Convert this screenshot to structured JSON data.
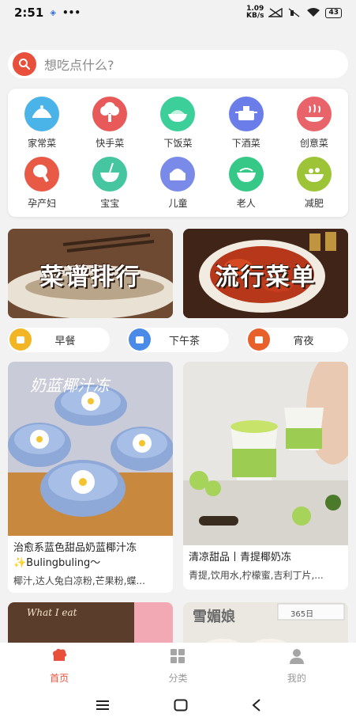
{
  "status_bar": {
    "time": "2:51",
    "net_speed_value": "1.09",
    "net_speed_unit": "KB/s",
    "battery": "43"
  },
  "search": {
    "placeholder": "想吃点什么?"
  },
  "categories": [
    {
      "label": "家常菜",
      "icon": "cloche-icon",
      "color": "#4ab3e8"
    },
    {
      "label": "快手菜",
      "icon": "broccoli-icon",
      "color": "#e85a5a"
    },
    {
      "label": "下饭菜",
      "icon": "rice-bowl-icon",
      "color": "#3ccf9a"
    },
    {
      "label": "下酒菜",
      "icon": "pot-icon",
      "color": "#6a7de8"
    },
    {
      "label": "创意菜",
      "icon": "steaming-dish-icon",
      "color": "#e8646a"
    },
    {
      "label": "孕产妇",
      "icon": "chicken-leg-icon",
      "color": "#e85a46"
    },
    {
      "label": "宝宝",
      "icon": "baby-bowl-icon",
      "color": "#45c6a0"
    },
    {
      "label": "儿童",
      "icon": "cake-icon",
      "color": "#7a8ae8"
    },
    {
      "label": "老人",
      "icon": "bowl-icon",
      "color": "#36c886"
    },
    {
      "label": "减肥",
      "icon": "salad-bowl-icon",
      "color": "#9cc436"
    }
  ],
  "banners": [
    {
      "label": "菜谱排行"
    },
    {
      "label": "流行菜单"
    }
  ],
  "meals": [
    {
      "label": "早餐",
      "icon": "breakfast-icon",
      "color": "#f2b523"
    },
    {
      "label": "下午茶",
      "icon": "tea-icon",
      "color": "#4a8be8"
    },
    {
      "label": "宵夜",
      "icon": "night-snack-icon",
      "color": "#e8602a"
    }
  ],
  "recipes": [
    {
      "overlay": "奶蓝椰汁冻",
      "title": "治愈系蓝色甜品奶蓝椰汁冻✨Bulingbuling～",
      "ingredients": "椰汁,达人兔白凉粉,芒果粉,蝶..."
    },
    {
      "title": "清凉甜品丨青提椰奶冻",
      "ingredients": "青提,饮用水,柠檬蜜,吉利丁片,..."
    },
    {
      "overlay": "What I eat"
    },
    {
      "overlay": "雪媚娘",
      "tag": "365日"
    }
  ],
  "tabs": [
    {
      "label": "首页",
      "icon": "chef-hat-icon",
      "active": true
    },
    {
      "label": "分类",
      "icon": "grid-icon",
      "active": false
    },
    {
      "label": "我的",
      "icon": "user-icon",
      "active": false
    }
  ]
}
